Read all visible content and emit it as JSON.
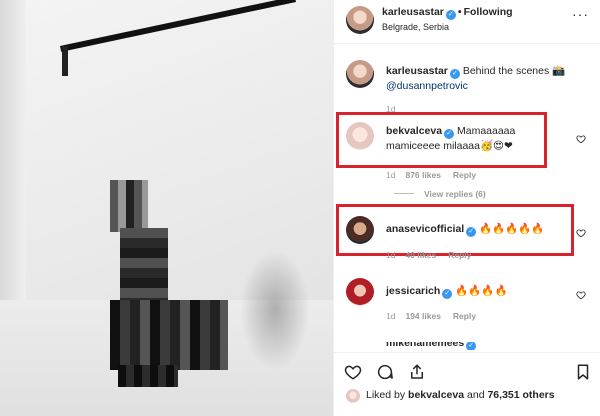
{
  "post": {
    "username": "karleusastar",
    "follow_status": "Following",
    "location": "Belgrade, Serbia",
    "more_icon": "more-dots-icon"
  },
  "caption": {
    "username": "karleusastar",
    "text": "Behind the scenes 📸",
    "mention": "@dusannpetrovic",
    "age": "1d"
  },
  "comments": [
    {
      "username": "bekvalceva",
      "text": "Mamaaaaaa mamiceeee milaaaa🥳😍❤",
      "age": "1d",
      "likes": "876 likes",
      "reply": "Reply",
      "view_replies": "View replies (6)"
    },
    {
      "username": "anasevicofficial",
      "text": "🔥🔥🔥🔥🔥",
      "age": "1d",
      "likes": "40 likes",
      "reply": "Reply"
    },
    {
      "username": "jessicarich",
      "text": "🔥🔥🔥🔥",
      "age": "1d",
      "likes": "194 likes",
      "reply": "Reply"
    },
    {
      "username": "mikenamemees",
      "text": ""
    }
  ],
  "footer": {
    "liked_by_prefix": "Liked by",
    "liked_by_user": "bekvalceva",
    "and": "and",
    "others": "76,351 others"
  },
  "colors": {
    "highlight_box": "#d6232c",
    "verified_badge": "#3897f0",
    "mention": "#003569"
  }
}
